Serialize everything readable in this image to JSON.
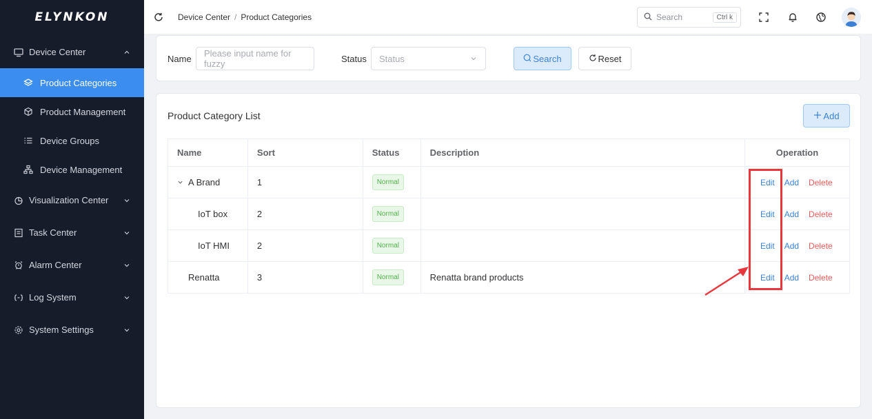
{
  "app": {
    "logo": "ELYNKON"
  },
  "sidebar": {
    "groups": [
      {
        "label": "Device Center",
        "icon": "monitor-icon",
        "expanded": true
      },
      {
        "label": "Visualization Center",
        "icon": "chart-pie-icon",
        "expanded": false
      },
      {
        "label": "Task Center",
        "icon": "task-list-icon",
        "expanded": false
      },
      {
        "label": "Alarm Center",
        "icon": "alarm-clock-icon",
        "expanded": false
      },
      {
        "label": "Log System",
        "icon": "log-brackets-icon",
        "expanded": false
      },
      {
        "label": "System Settings",
        "icon": "gear-icon",
        "expanded": false
      }
    ],
    "device_center_items": [
      {
        "label": "Product Categories",
        "icon": "layers-icon",
        "active": true
      },
      {
        "label": "Product Management",
        "icon": "cube-icon",
        "active": false
      },
      {
        "label": "Device Groups",
        "icon": "list-icon",
        "active": false
      },
      {
        "label": "Device Management",
        "icon": "sitemap-icon",
        "active": false
      }
    ]
  },
  "header": {
    "breadcrumb": [
      "Device Center",
      "Product Categories"
    ],
    "breadcrumb_separator": "/",
    "search_placeholder": "Search",
    "search_shortcut": "Ctrl k",
    "icons": [
      "fullscreen-icon",
      "bell-icon",
      "globe-icon"
    ]
  },
  "filter": {
    "name_label": "Name",
    "name_placeholder": "Please input name for fuzzy",
    "status_label": "Status",
    "status_placeholder": "Status",
    "search_button": "Search",
    "reset_button": "Reset"
  },
  "list": {
    "title": "Product Category List",
    "add_button": "Add",
    "columns": [
      "Name",
      "Sort",
      "Status",
      "Description",
      "Operation"
    ],
    "rows": [
      {
        "name": "A Brand",
        "sort": "1",
        "status": "Normal",
        "description": "",
        "has_children": true,
        "level": 0
      },
      {
        "name": "IoT box",
        "sort": "2",
        "status": "Normal",
        "description": "",
        "has_children": false,
        "level": 1
      },
      {
        "name": "IoT HMI",
        "sort": "2",
        "status": "Normal",
        "description": "",
        "has_children": false,
        "level": 1
      },
      {
        "name": "Renatta",
        "sort": "3",
        "status": "Normal",
        "description": "Renatta brand products",
        "has_children": false,
        "level": 0
      }
    ],
    "operations": {
      "edit": "Edit",
      "add": "Add",
      "delete": "Delete"
    }
  },
  "colors": {
    "sidebar_bg": "#171c2b",
    "accent": "#3b8df0",
    "link": "#3b82d6",
    "danger": "#ef5b5b",
    "success": "#52b14a",
    "annotation": "#e8383d"
  }
}
